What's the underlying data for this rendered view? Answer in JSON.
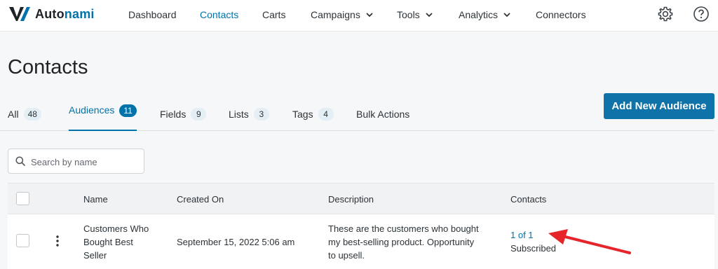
{
  "brand": {
    "name_a": "Auto",
    "name_b": "nami"
  },
  "nav": {
    "items": [
      {
        "label": "Dashboard",
        "active": false,
        "dropdown": false
      },
      {
        "label": "Contacts",
        "active": true,
        "dropdown": false
      },
      {
        "label": "Carts",
        "active": false,
        "dropdown": false
      },
      {
        "label": "Campaigns",
        "active": false,
        "dropdown": true
      },
      {
        "label": "Tools",
        "active": false,
        "dropdown": true
      },
      {
        "label": "Analytics",
        "active": false,
        "dropdown": true
      },
      {
        "label": "Connectors",
        "active": false,
        "dropdown": false
      }
    ],
    "icons": [
      "gear-icon",
      "help-icon"
    ]
  },
  "page": {
    "title": "Contacts"
  },
  "tabs": [
    {
      "label": "All",
      "count": "48",
      "active": false
    },
    {
      "label": "Audiences",
      "count": "11",
      "active": true
    },
    {
      "label": "Fields",
      "count": "9",
      "active": false
    },
    {
      "label": "Lists",
      "count": "3",
      "active": false
    },
    {
      "label": "Tags",
      "count": "4",
      "active": false
    },
    {
      "label": "Bulk Actions",
      "count": null,
      "active": false
    }
  ],
  "actions": {
    "add_audience_label": "Add New Audience"
  },
  "search": {
    "placeholder": "Search by name",
    "value": ""
  },
  "table": {
    "columns": [
      "Name",
      "Created On",
      "Description",
      "Contacts"
    ],
    "rows": [
      {
        "name_lines": [
          "Customers Who",
          "Bought Best",
          "Seller"
        ],
        "created_on": "September 15, 2022 5:06 am",
        "description_lines": [
          "These are the customers who bought",
          "my best-selling product. Opportunity",
          "to upsell."
        ],
        "contacts_link": "1 of 1",
        "contacts_status": "Subscribed"
      }
    ]
  },
  "colors": {
    "accent": "#0073aa",
    "button": "#0f72a8",
    "annotation_arrow": "#e5252a"
  }
}
